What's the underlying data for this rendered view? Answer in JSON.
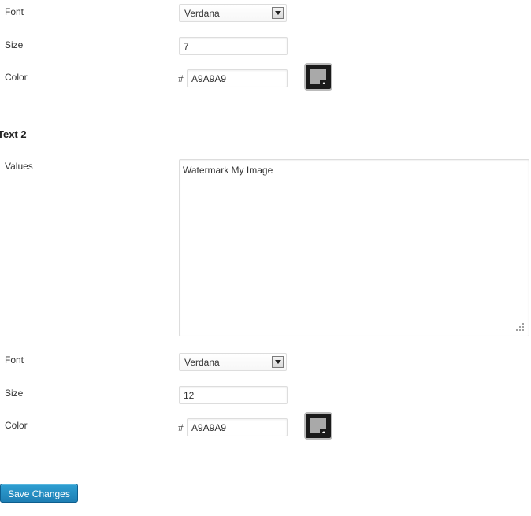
{
  "text1": {
    "font_label": "Font",
    "font_value": "Verdana",
    "size_label": "Size",
    "size_value": "7",
    "color_label": "Color",
    "hash": "#",
    "color_value": "A9A9A9",
    "swatch_color": "#a9a9a9"
  },
  "text2": {
    "heading": "Text 2",
    "values_label": "Values",
    "values_value": "Watermark My Image",
    "font_label": "Font",
    "font_value": "Verdana",
    "size_label": "Size",
    "size_value": "12",
    "color_label": "Color",
    "hash": "#",
    "color_value": "A9A9A9",
    "swatch_color": "#a9a9a9"
  },
  "actions": {
    "save_label": "Save Changes"
  },
  "colors": {
    "accent": "#2381b8",
    "swatch_frame": "#1a1a1a"
  },
  "icons": {
    "select_arrow": "chevron-down-icon",
    "color_picker": "color-swatch-icon",
    "resize_grip": "resize-grip-icon"
  }
}
